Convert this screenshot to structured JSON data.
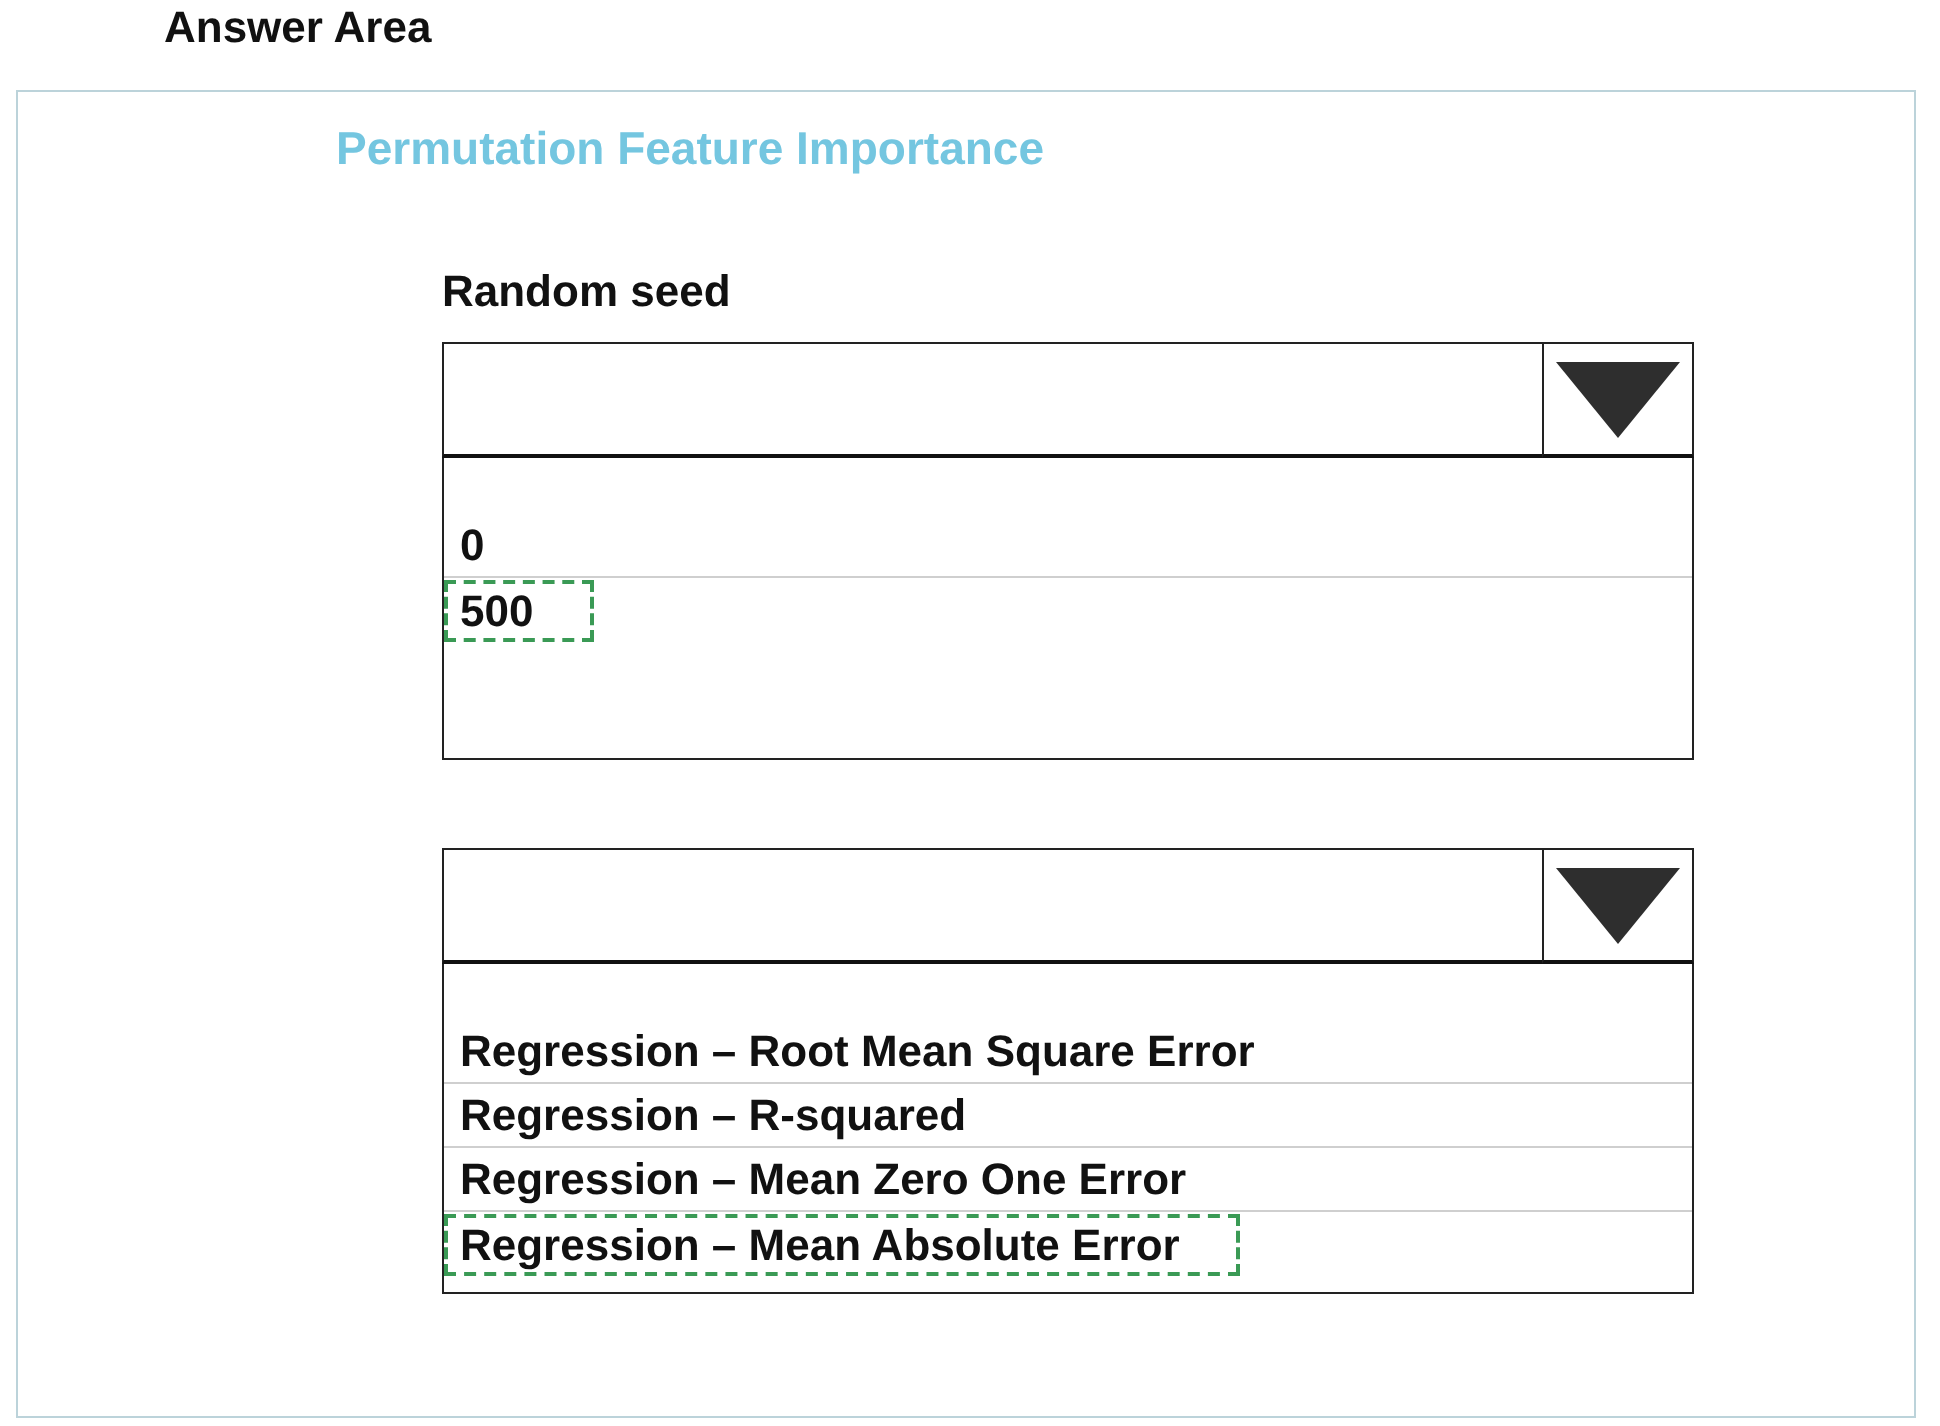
{
  "heading": "Answer Area",
  "panel": {
    "title": "Permutation Feature Importance",
    "dropdowns": [
      {
        "label": "Random seed",
        "options": [
          {
            "text": "0",
            "selected": false
          },
          {
            "text": "500",
            "selected": true
          }
        ]
      },
      {
        "options": [
          {
            "text": "Regression – Root Mean Square Error",
            "selected": false
          },
          {
            "text": "Regression – R-squared",
            "selected": false
          },
          {
            "text": "Regression – Mean Zero One Error",
            "selected": false
          },
          {
            "text": "Regression – Mean Absolute Error",
            "selected": true
          }
        ]
      }
    ]
  }
}
